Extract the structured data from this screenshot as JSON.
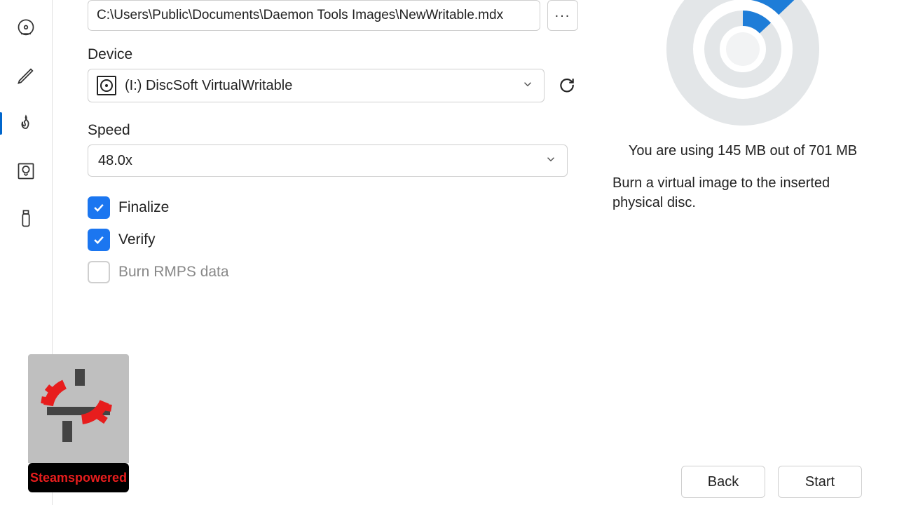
{
  "path": {
    "value": "C:\\Users\\Public\\Documents\\Daemon Tools Images\\NewWritable.mdx",
    "browse_label": "..."
  },
  "device": {
    "label": "Device",
    "selected": "(I:) DiscSoft VirtualWritable"
  },
  "speed": {
    "label": "Speed",
    "selected": "48.0x"
  },
  "checks": {
    "finalize": {
      "label": "Finalize",
      "checked": true
    },
    "verify": {
      "label": "Verify",
      "checked": true
    },
    "rmps": {
      "label": "Burn RMPS data",
      "checked": false
    }
  },
  "usage": {
    "text": "You are using 145 MB out of 701 MB",
    "description": "Burn a virtual image to the inserted physical disc.",
    "used_mb": 145,
    "total_mb": 701
  },
  "buttons": {
    "back": "Back",
    "start": "Start"
  },
  "logo": {
    "label": "Steamspowered"
  }
}
